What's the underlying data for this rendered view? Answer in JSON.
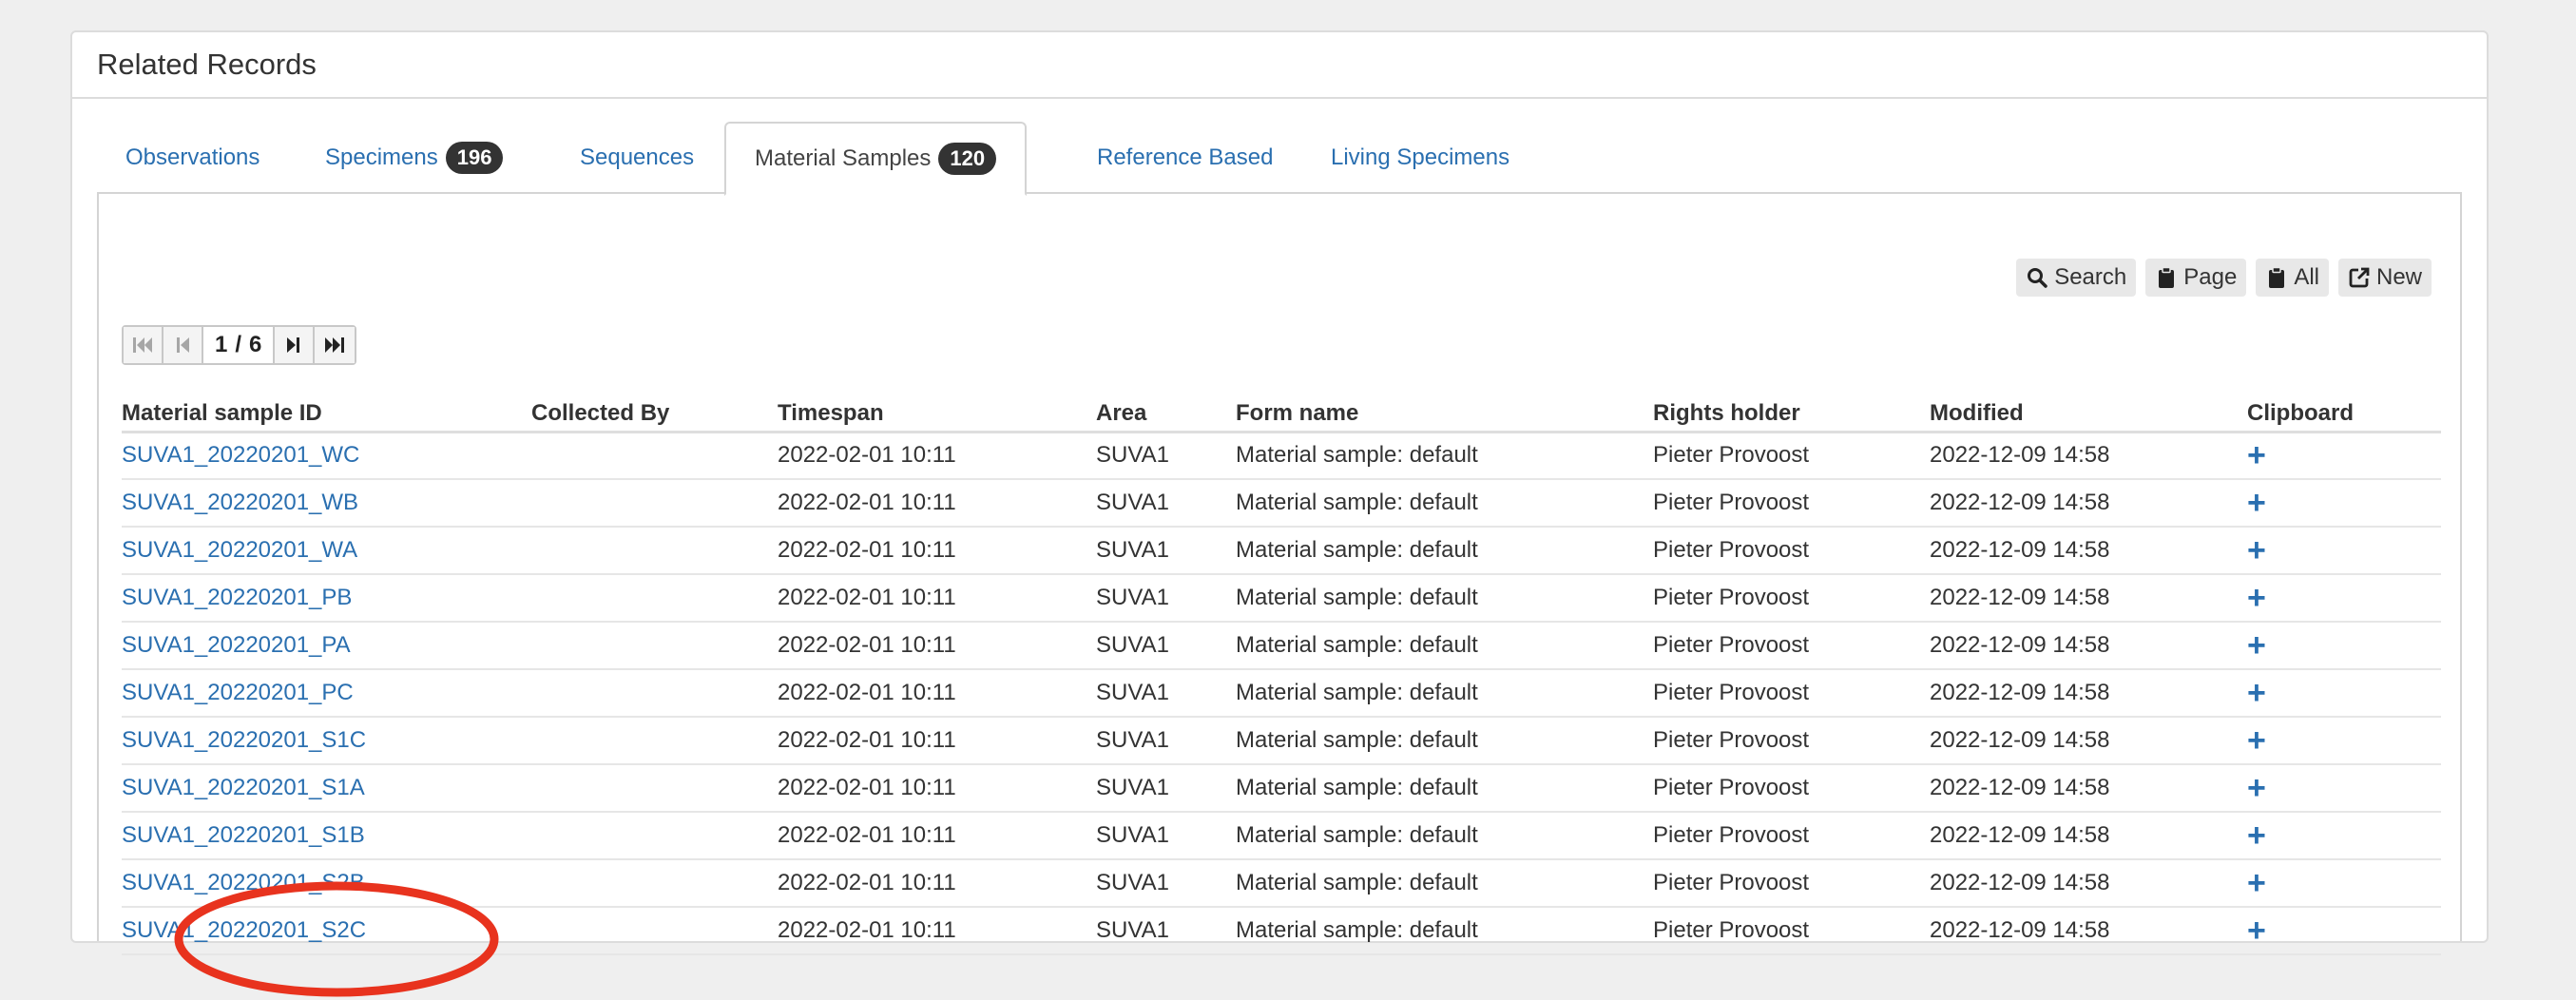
{
  "panel": {
    "title": "Related Records"
  },
  "tabs": [
    {
      "label": "Observations",
      "badge": null,
      "active": false
    },
    {
      "label": "Specimens",
      "badge": "196",
      "active": false
    },
    {
      "label": "Sequences",
      "badge": null,
      "active": false
    },
    {
      "label": "Material Samples",
      "badge": "120",
      "active": true
    },
    {
      "label": "Reference Based",
      "badge": null,
      "active": false
    },
    {
      "label": "Living Specimens",
      "badge": null,
      "active": false
    }
  ],
  "toolbar": {
    "search_label": "Search",
    "page_label": "Page",
    "all_label": "All",
    "new_label": "New"
  },
  "pager": {
    "current": "1",
    "separator": "/",
    "total": "6"
  },
  "table": {
    "columns": [
      "Material sample ID",
      "Collected By",
      "Timespan",
      "Area",
      "Form name",
      "Rights holder",
      "Modified",
      "Clipboard"
    ],
    "rows": [
      [
        "SUVA1_20220201_WC",
        "",
        "2022-02-01 10:11",
        "SUVA1",
        "Material sample: default",
        "Pieter Provoost",
        "2022-12-09 14:58",
        "+"
      ],
      [
        "SUVA1_20220201_WB",
        "",
        "2022-02-01 10:11",
        "SUVA1",
        "Material sample: default",
        "Pieter Provoost",
        "2022-12-09 14:58",
        "+"
      ],
      [
        "SUVA1_20220201_WA",
        "",
        "2022-02-01 10:11",
        "SUVA1",
        "Material sample: default",
        "Pieter Provoost",
        "2022-12-09 14:58",
        "+"
      ],
      [
        "SUVA1_20220201_PB",
        "",
        "2022-02-01 10:11",
        "SUVA1",
        "Material sample: default",
        "Pieter Provoost",
        "2022-12-09 14:58",
        "+"
      ],
      [
        "SUVA1_20220201_PA",
        "",
        "2022-02-01 10:11",
        "SUVA1",
        "Material sample: default",
        "Pieter Provoost",
        "2022-12-09 14:58",
        "+"
      ],
      [
        "SUVA1_20220201_PC",
        "",
        "2022-02-01 10:11",
        "SUVA1",
        "Material sample: default",
        "Pieter Provoost",
        "2022-12-09 14:58",
        "+"
      ],
      [
        "SUVA1_20220201_S1C",
        "",
        "2022-02-01 10:11",
        "SUVA1",
        "Material sample: default",
        "Pieter Provoost",
        "2022-12-09 14:58",
        "+"
      ],
      [
        "SUVA1_20220201_S1A",
        "",
        "2022-02-01 10:11",
        "SUVA1",
        "Material sample: default",
        "Pieter Provoost",
        "2022-12-09 14:58",
        "+"
      ],
      [
        "SUVA1_20220201_S1B",
        "",
        "2022-02-01 10:11",
        "SUVA1",
        "Material sample: default",
        "Pieter Provoost",
        "2022-12-09 14:58",
        "+"
      ],
      [
        "SUVA1_20220201_S2B",
        "",
        "2022-02-01 10:11",
        "SUVA1",
        "Material sample: default",
        "Pieter Provoost",
        "2022-12-09 14:58",
        "+"
      ],
      [
        "SUVA1_20220201_S2C",
        "",
        "2022-02-01 10:11",
        "SUVA1",
        "Material sample: default",
        "Pieter Provoost",
        "2022-12-09 14:58",
        "+"
      ]
    ]
  },
  "colors": {
    "link": "#2a6fb0",
    "badge": "#333333",
    "annotation": "#e8331e"
  },
  "annotation": {
    "shape": "ellipse",
    "highlighted_row": "SUVA1_20220201_S1A"
  }
}
